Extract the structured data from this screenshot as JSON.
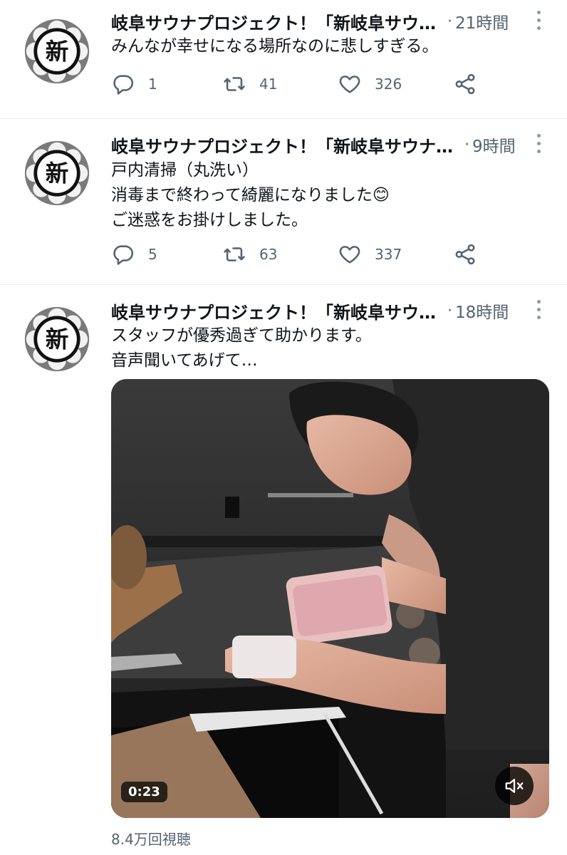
{
  "tweets": [
    {
      "name": "岐阜サウナプロジェクト！「新岐阜サウ…",
      "dot": "·",
      "time": "21時間",
      "lines": [
        "みんなが幸せになる場所なのに悲しすぎる。"
      ],
      "replies": "1",
      "retweets": "41",
      "likes": "326"
    },
    {
      "name": "岐阜サウナプロジェクト！「新岐阜サウナ…",
      "dot": "·",
      "time": "9時間",
      "lines": [
        "戸内清掃（丸洗い）",
        "消毒まで終わって綺麗になりました",
        "ご迷惑をお掛けしました。"
      ],
      "emoji": "😊",
      "replies": "5",
      "retweets": "63",
      "likes": "337"
    },
    {
      "name": "岐阜サウナプロジェクト！「新岐阜サウ…",
      "dot": "·",
      "time": "18時間",
      "lines": [
        "スタッフが優秀過ぎて助かります。",
        "音声聞いてあげて…"
      ],
      "video": {
        "duration": "0:23",
        "views": "8.4万回視聴"
      }
    }
  ],
  "avatar": {
    "glyph": "新"
  },
  "icons": {
    "reply": "reply-icon",
    "retweet": "retweet-icon",
    "like": "heart-icon",
    "share": "share-icon",
    "more": "more-vertical-icon",
    "mute": "mute-icon"
  },
  "colors": {
    "text": "#0f1419",
    "secondary": "#536471",
    "divider": "#e6ecf0"
  }
}
